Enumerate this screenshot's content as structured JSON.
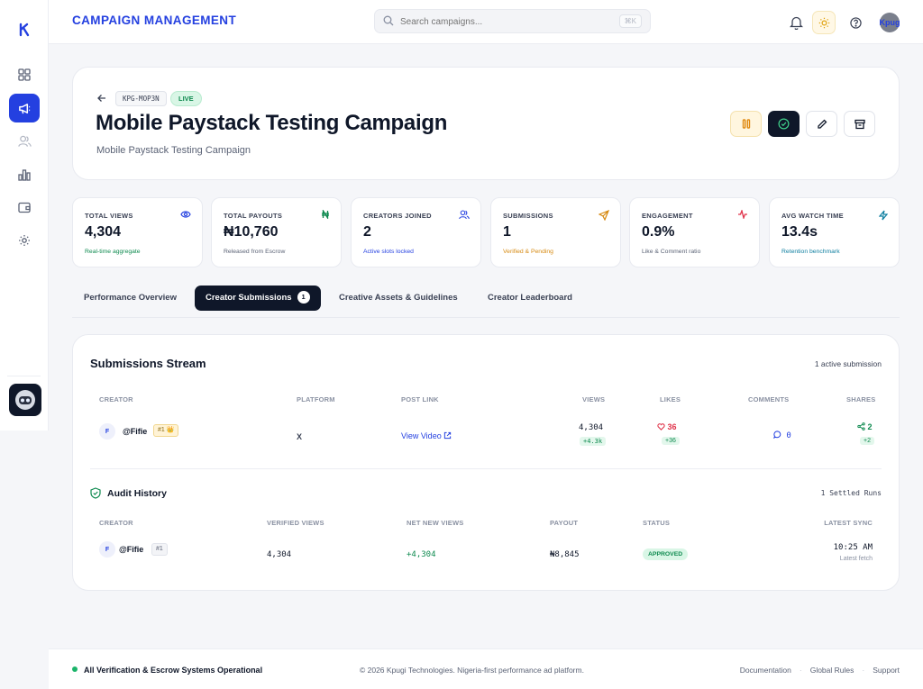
{
  "header": {
    "title": "CAMPAIGN MANAGEMENT",
    "search_placeholder": "Search campaigns...",
    "search_shortcut": "⌘K",
    "avatar_text": "Kpug"
  },
  "campaign": {
    "code": "KPG-MOP3N",
    "status": "LIVE",
    "title": "Mobile Paystack Testing Campaign",
    "subtitle": "Mobile Paystack Testing Campaign"
  },
  "stats": [
    {
      "label": "TOTAL VIEWS",
      "value": "4,304",
      "note": "Real-time aggregate",
      "note_color": "#0e8a4f",
      "icon": "eye-icon"
    },
    {
      "label": "TOTAL PAYOUTS",
      "value": "₦10,760",
      "note": "Released from Escrow",
      "note_color": "#5a6275",
      "icon": "naira-icon"
    },
    {
      "label": "CREATORS JOINED",
      "value": "2",
      "note": "Active slots locked",
      "note_color": "#2440e0",
      "icon": "users-icon"
    },
    {
      "label": "SUBMISSIONS",
      "value": "1",
      "note": "Verified & Pending",
      "note_color": "#d68910",
      "icon": "send-icon"
    },
    {
      "label": "ENGAGEMENT",
      "value": "0.9%",
      "note": "Like & Comment ratio",
      "note_color": "#5a6275",
      "icon": "activity-icon"
    },
    {
      "label": "AVG WATCH TIME",
      "value": "13.4s",
      "note": "Retention benchmark",
      "note_color": "#0f7fa0",
      "icon": "bolt-icon"
    }
  ],
  "tabs": [
    {
      "label": "Performance Overview"
    },
    {
      "label": "Creator Submissions",
      "count": "1"
    },
    {
      "label": "Creative Assets & Guidelines"
    },
    {
      "label": "Creator Leaderboard"
    }
  ],
  "submissions": {
    "title": "Submissions Stream",
    "active_count": "1 active submission",
    "columns": [
      "CREATOR",
      "PLATFORM",
      "POST LINK",
      "VIEWS",
      "LIKES",
      "COMMENTS",
      "SHARES"
    ],
    "row": {
      "initial": "F",
      "handle": "@Fifie",
      "rank": "#1 👑",
      "platform": "X",
      "link": "View Video",
      "views": "4,304",
      "views_delta": "+4.3k",
      "likes": "36",
      "likes_delta": "+36",
      "comments": "0",
      "shares": "2",
      "shares_delta": "+2"
    }
  },
  "audit": {
    "title": "Audit History",
    "settled": "1 Settled Runs",
    "columns": [
      "CREATOR",
      "VERIFIED VIEWS",
      "NET NEW VIEWS",
      "PAYOUT",
      "STATUS",
      "LATEST SYNC"
    ],
    "row": {
      "initial": "F",
      "handle": "@Fifie",
      "rank": "#1",
      "verified_views": "4,304",
      "net_new": "+4,304",
      "payout": "₦8,845",
      "status": "APPROVED",
      "sync_time": "10:25 AM",
      "sync_note": "Latest fetch"
    }
  },
  "footer": {
    "status": "All Verification & Escrow Systems Operational",
    "copyright": "© 2026 Kpugi Technologies. Nigeria-first performance ad platform.",
    "links": [
      "Documentation",
      "Global Rules",
      "Support"
    ]
  },
  "colors": {
    "brand": "#2440e0",
    "dark": "#0f1729",
    "success": "#0e8a4f",
    "danger": "#e0334a"
  }
}
